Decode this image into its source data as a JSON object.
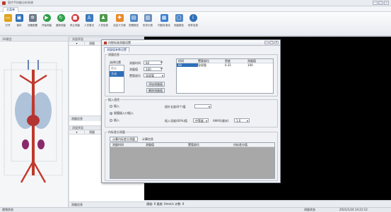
{
  "window": {
    "title": "医疗手技能分析系统",
    "controls": [
      "—",
      "□",
      "×"
    ]
  },
  "menu": {
    "tab": "主菜单"
  },
  "ribbon": {
    "buttons": [
      {
        "label": "打开",
        "icon": "folder-icon",
        "color": "#e0a21c"
      },
      {
        "label": "保存",
        "icon": "save-icon",
        "color": "#2f6fb8"
      },
      {
        "label": "设备配置",
        "icon": "gear-icon",
        "color": "#6d7a8a"
      },
      {
        "label": "开始测量",
        "icon": "play-icon",
        "color": "#2e9e4a"
      },
      {
        "label": "重新测量",
        "icon": "refresh-icon",
        "color": "#2e9e4a"
      },
      {
        "label": "停止测量",
        "icon": "stop-icon",
        "color": "#d23c3c"
      },
      {
        "label": "人员登记",
        "icon": "person-icon",
        "color": "#3a7abf"
      },
      {
        "label": "人员信息",
        "icon": "people-icon",
        "color": "#4a9a4a"
      },
      {
        "label": "自定义方案",
        "icon": "puzzle-icon",
        "color": "#e88a2b"
      },
      {
        "label": "查看报告",
        "icon": "report-icon",
        "color": "#4f86c6"
      },
      {
        "label": "历史记录",
        "icon": "history-icon",
        "color": "#6a8fbf"
      },
      {
        "label": "内腔标准化",
        "icon": "chart-icon",
        "color": "#3d7fd0"
      },
      {
        "label": "测量报告",
        "icon": "document-icon",
        "color": "#4f86c6"
      },
      {
        "label": "软件信息",
        "icon": "info-icon",
        "color": "#2f6fb8"
      }
    ]
  },
  "left_panel": {
    "title": "3D模型"
  },
  "center": {
    "top_header": "测量界面",
    "col_measure": "测量",
    "info_label": "测量信息",
    "bottom_header": "测量界面",
    "bottom_col_measure": "测量",
    "bottom_info_label": "测量信息"
  },
  "status": {
    "left": "就绪状态",
    "fields": "通道: 0   速度: 0mm/s   计数: 0",
    "right_label": "测量状态",
    "datetime": "2021/1/24 14:21:12"
  },
  "dialog": {
    "title": "内腔标准测量设置",
    "tab": "测量值参数设置",
    "group1": "测量信息",
    "select_label": "选择位置",
    "list": [
      "右心",
      "主动"
    ],
    "time_label": "测量时间",
    "time_value": "60",
    "value_label": "测量值",
    "value_value": "100",
    "site_label": "置管部位",
    "site_value": "导尿管",
    "add_btn": "添加测量值",
    "del_btn": "删除测量值",
    "table_headers": [
      "时间",
      "置管部位",
      "密度",
      "测量值"
    ],
    "table_row": [
      "60",
      "导尿管",
      "0.31",
      "100"
    ],
    "group2": "插入途径",
    "radio_insert": "插入",
    "radio_insert_sel": "胆管插入口插入",
    "radio_other": "插入",
    "check_label": "插针长度(8个)值",
    "depth_label": "插入深度(60%)值",
    "depth_value": "中等度",
    "amas_label": "AMAS(厘米)",
    "amas_value": "1.0",
    "group3": "内标差分测量",
    "tab_calc": "计算内标差分测量",
    "tab_calc2": "计算信息",
    "bottom_headers": [
      "测量时间",
      "测量值",
      "置管部位",
      "内标差分值"
    ]
  }
}
